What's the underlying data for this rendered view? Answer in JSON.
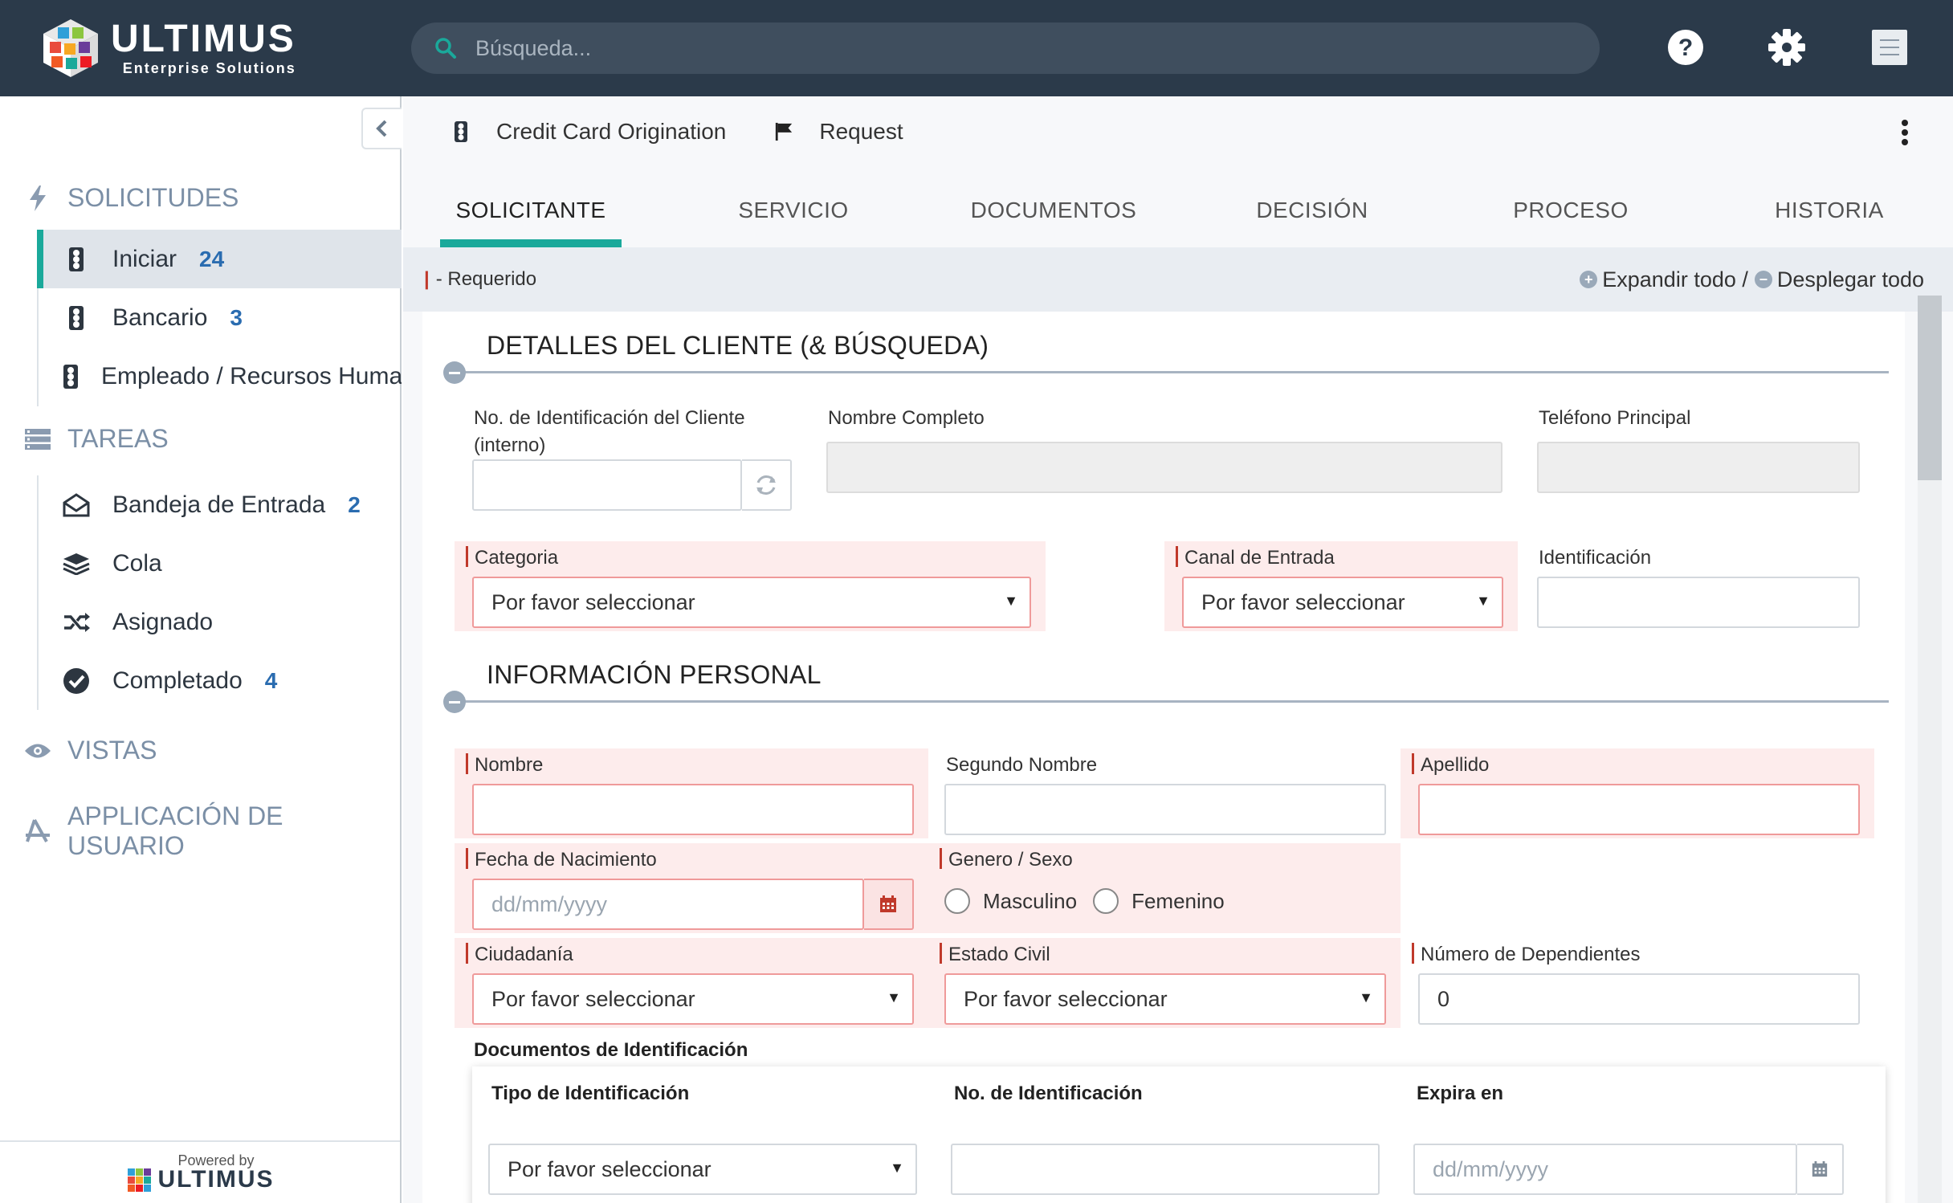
{
  "brand": {
    "name": "ULTIMUS",
    "tagline": "Enterprise Solutions"
  },
  "search": {
    "placeholder": "Búsqueda..."
  },
  "topbar": {
    "icons": [
      "help-icon",
      "gear-icon",
      "menu-icon"
    ]
  },
  "sidebar": {
    "sections": {
      "solicitudes": "SOLICITUDES",
      "tareas": "TAREAS",
      "vistas": "VISTAS",
      "app": "APPLICACIÓN DE USUARIO"
    },
    "solicitudes_items": [
      {
        "label": "Iniciar",
        "count": "24"
      },
      {
        "label": "Bancario",
        "count": "3"
      },
      {
        "label": "Empleado / Recursos Humanos",
        "count": ""
      }
    ],
    "tareas_items": [
      {
        "label": "Bandeja de Entrada",
        "count": "2"
      },
      {
        "label": "Cola",
        "count": ""
      },
      {
        "label": "Asignado",
        "count": ""
      },
      {
        "label": "Completado",
        "count": "4"
      }
    ],
    "footer": {
      "powered_by": "Powered by",
      "brand": "ULTIMUS"
    }
  },
  "breadcrumb": {
    "process": "Credit Card Origination",
    "step": "Request"
  },
  "tabs": [
    "SOLICITANTE",
    "SERVICIO",
    "DOCUMENTOS",
    "DECISIÓN",
    "PROCESO",
    "HISTORIA"
  ],
  "active_tab": "SOLICITANTE",
  "reqbar": {
    "required_label": "- Requerido",
    "expand": "Expandir todo /",
    "collapse": "Desplegar todo"
  },
  "section1": {
    "title": "DETALLES DEL CLIENTE (& BÚSQUEDA)",
    "client_id_label": "No. de Identificación del Cliente (interno)",
    "full_name_label": "Nombre Completo",
    "phone_label": "Teléfono Principal",
    "category_label": "Categoria",
    "category_value": "Por favor seleccionar",
    "channel_label": "Canal de Entrada",
    "channel_value": "Por favor seleccionar",
    "identification_label": "Identificación"
  },
  "section2": {
    "title": "INFORMACIÓN PERSONAL",
    "first_name": "Nombre",
    "middle_name": "Segundo Nombre",
    "last_name": "Apellido",
    "birth_date": "Fecha de Nacimiento",
    "birth_placeholder": "dd/mm/yyyy",
    "gender": "Genero / Sexo",
    "male": "Masculino",
    "female": "Femenino",
    "citizenship": "Ciudadanía",
    "citizenship_value": "Por favor seleccionar",
    "civil_status": "Estado Civil",
    "civil_status_value": "Por favor seleccionar",
    "dependents": "Número de Dependientes",
    "dependents_value": "0",
    "id_docs": "Documentos de Identificación",
    "columns": [
      "Tipo de Identificación",
      "No. de Identificación",
      "Expira en"
    ],
    "row": {
      "type_value": "Por favor seleccionar",
      "expires_placeholder": "dd/mm/yyyy"
    }
  },
  "colors": {
    "topbar": "#2b3a4a",
    "accent": "#1aa99b",
    "required": "#c0392b",
    "count": "#2a6cb0"
  }
}
